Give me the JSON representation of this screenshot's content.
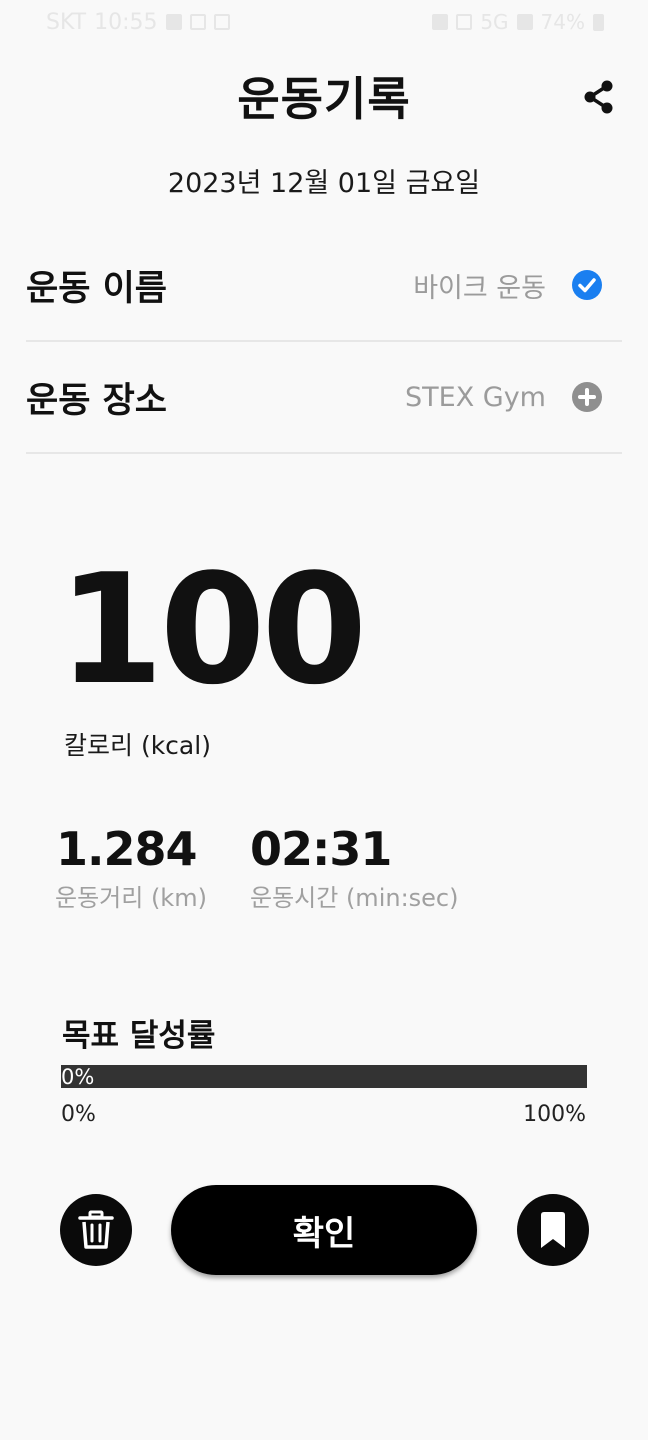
{
  "status_bar": {
    "carrier": "SKT",
    "time": "10:55",
    "signal": "5G",
    "battery": "74%"
  },
  "header": {
    "title": "운동기록",
    "share_icon": "share-icon"
  },
  "date": "2023년 12월 01일 금요일",
  "fields": [
    {
      "label": "운동 이름",
      "value": "바이크 운동",
      "icon": "check-circle-icon",
      "color": "#1a7ff0"
    },
    {
      "label": "운동 장소",
      "value": "STEX Gym",
      "icon": "plus-circle-icon",
      "color": "#8f8f8f"
    }
  ],
  "calories": {
    "value": "100",
    "label": "칼로리 (kcal)"
  },
  "stats": [
    {
      "value": "1.284",
      "label": "운동거리 (km)"
    },
    {
      "value": "02:31",
      "label": "운동시간 (min:sec)"
    }
  ],
  "goal": {
    "title": "목표 달성률",
    "percent_text": "0%",
    "progress": 0,
    "min_label": "0%",
    "max_label": "100%"
  },
  "actions": {
    "delete_icon": "trash-icon",
    "confirm_label": "확인",
    "bookmark_icon": "bookmark-icon"
  }
}
